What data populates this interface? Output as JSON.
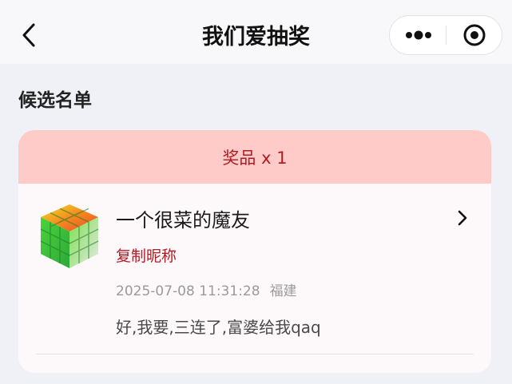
{
  "navbar": {
    "title": "我们爱抽奖",
    "back_icon": "chevron-left-icon",
    "more_icon": "more-dots-icon",
    "close_icon": "target-circle-icon"
  },
  "section": {
    "title": "候选名单"
  },
  "prize": {
    "label": "奖品 x 1"
  },
  "entry": {
    "nickname": "一个很菜的魔友",
    "copy_label": "复制昵称",
    "datetime": "2025-07-08 11:31:28",
    "location": "福建",
    "comment": "好,我要,三连了,富婆给我qaq",
    "avatar_icon": "rubiks-cube-avatar"
  },
  "colors": {
    "accent_red": "#b01c24",
    "prize_header_bg": "#fecbc9",
    "page_bg": "#f0f1f6"
  }
}
